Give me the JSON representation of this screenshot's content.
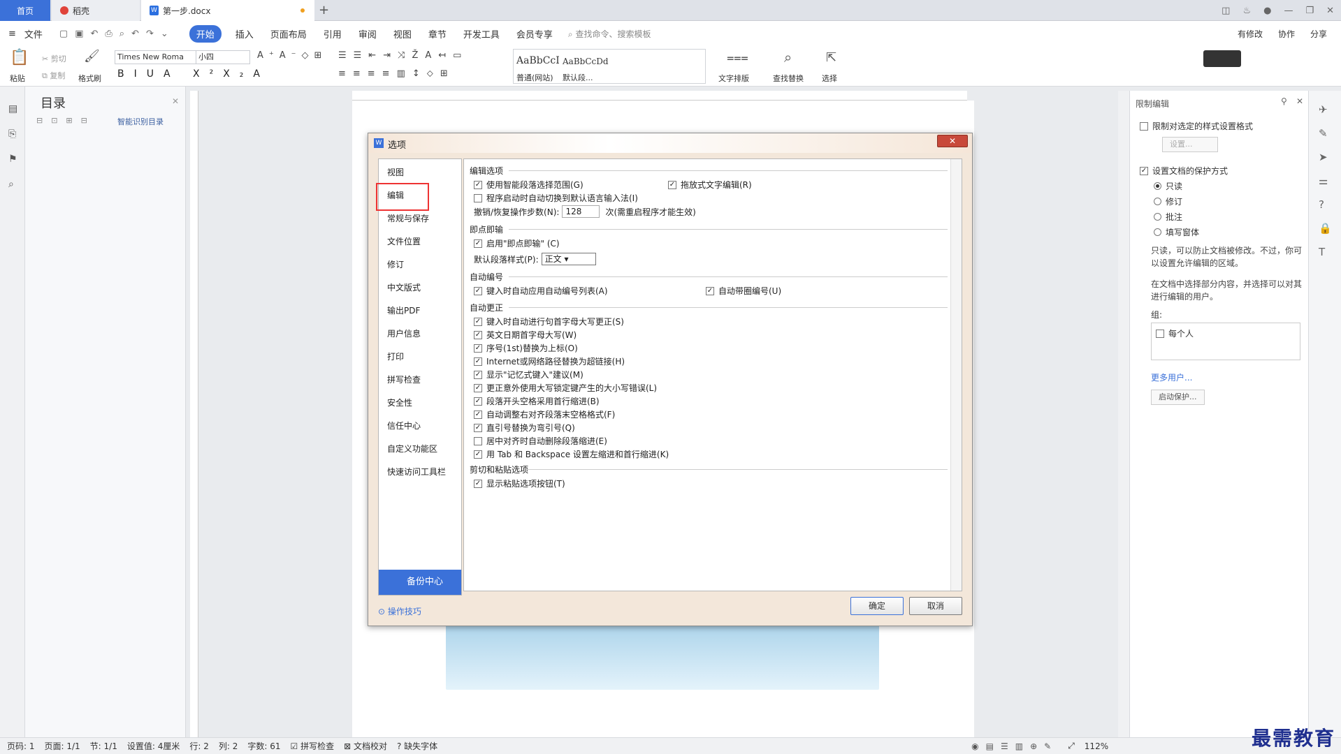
{
  "tabs": {
    "home": "首页",
    "shell": "稻壳",
    "doc": "第一步.docx"
  },
  "menu": {
    "file": "文件",
    "items": [
      "开始",
      "插入",
      "页面布局",
      "引用",
      "审阅",
      "视图",
      "章节",
      "开发工具",
      "会员专享"
    ],
    "search": "查找命令、搜索模板",
    "right": [
      "有修改",
      "协作",
      "分享"
    ]
  },
  "ribbon": {
    "paste": "粘贴",
    "cut": "剪切",
    "copy": "复制",
    "format_painter": "格式刷",
    "font_name": "Times New Roma",
    "font_size": "小四",
    "style1_preview": "AaBbCcI",
    "style1_name": "普通(网站)",
    "style2_preview": "AaBbCcDd",
    "style2_name": "默认段...",
    "text_layout": "文字排版",
    "find_replace": "查找替换",
    "select": "选择"
  },
  "toc": {
    "title": "目录",
    "ai": "智能识别目录"
  },
  "dialog": {
    "title": "选项",
    "nav": [
      "视图",
      "编辑",
      "常规与保存",
      "文件位置",
      "修订",
      "中文版式",
      "输出PDF",
      "用户信息",
      "打印",
      "拼写检查",
      "安全性",
      "信任中心",
      "自定义功能区",
      "快速访问工具栏"
    ],
    "backup": "备份中心",
    "tips": "操作技巧",
    "sections": {
      "edit": "编辑选项",
      "instant": "即点即输",
      "autonum": "自动编号",
      "autocorrect": "自动更正",
      "cutpaste": "剪切和粘贴选项"
    },
    "options": {
      "smart_para": "使用智能段落选择范围(G)",
      "drag_edit": "拖放式文字编辑(R)",
      "auto_lang": "程序启动时自动切换到默认语言输入法(I)",
      "undo_label": "撤销/恢复操作步数(N):",
      "undo_value": "128",
      "undo_note": "次(需重启程序才能生效)",
      "enable_instant": "启用\"即点即输\" (C)",
      "default_para_label": "默认段落样式(P):",
      "default_para_value": "正文",
      "auto_list": "键入时自动应用自动编号列表(A)",
      "auto_circle": "自动带圈编号(U)",
      "ac1": "键入时自动进行句首字母大写更正(S)",
      "ac2": "英文日期首字母大写(W)",
      "ac3": "序号(1st)替换为上标(O)",
      "ac4": "Internet或网络路径替换为超链接(H)",
      "ac5": "显示\"记忆式键入\"建议(M)",
      "ac6": "更正意外使用大写锁定键产生的大小写错误(L)",
      "ac7": "段落开头空格采用首行缩进(B)",
      "ac8": "自动调整右对齐段落末空格格式(F)",
      "ac9": "直引号替换为弯引号(Q)",
      "ac10": "居中对齐时自动删除段落缩进(E)",
      "ac11": "用 Tab 和 Backspace 设置左缩进和首行缩进(K)",
      "show_paste": "显示粘贴选项按钮(T)"
    },
    "ok": "确定",
    "cancel": "取消"
  },
  "restrict": {
    "title": "限制编辑",
    "format_limit": "限制对选定的样式设置格式",
    "settings": "设置...",
    "protect": "设置文档的保护方式",
    "modes": [
      "只读",
      "修订",
      "批注",
      "填写窗体"
    ],
    "desc1": "只读，可以防止文档被修改。不过，你可以设置允许编辑的区域。",
    "desc2": "在文档中选择部分内容，并选择可以对其进行编辑的用户。",
    "group": "组:",
    "everyone": "每个人",
    "more_users": "更多用户...",
    "start": "启动保护..."
  },
  "status": {
    "page_num": "页码: 1",
    "page": "页面: 1/1",
    "section": "节: 1/1",
    "setting": "设置值: 4厘米",
    "row": "行: 2",
    "col": "列: 2",
    "words": "字数: 61",
    "spell": "拼写检查",
    "proof": "文档校对",
    "missing_font": "缺失字体",
    "zoom": "112%"
  },
  "watermark": "最需教育",
  "colors": {
    "accent": "#3b71d9",
    "highlight": "#e33333"
  }
}
